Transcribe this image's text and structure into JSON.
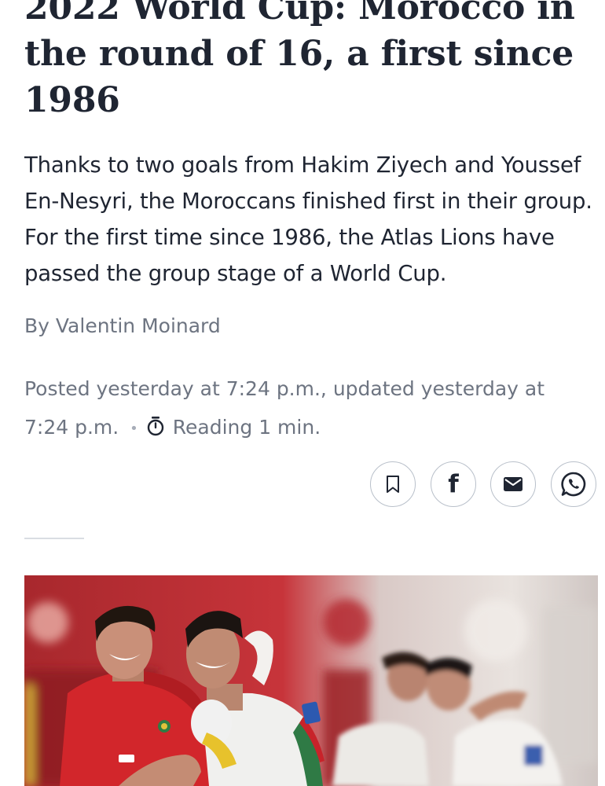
{
  "article": {
    "headline": "2022 World Cup: Morocco in the round of 16, a first since 1986",
    "lede": "Thanks to two goals from Hakim Ziyech and Youssef En-Nesyri, the Moroccans finished first in their group. For the first time since 1986, the Atlas Lions have passed the group stage of a World Cup.",
    "byline": "By Valentin Moinard",
    "posted": "Posted yesterday at 7:24 p.m., updated yesterday at 7:24 p.m.",
    "separator": "•",
    "reading_time": "Reading 1 min."
  },
  "share": {
    "facebook_glyph": "f",
    "buttons": [
      "bookmark-icon",
      "facebook-icon",
      "email-icon",
      "whatsapp-icon"
    ]
  },
  "photo": {
    "content": "celebrating Morocco players",
    "colors": {
      "jersey_red": "#d2262b",
      "jersey_white": "#efefed",
      "background_crowd": "#c03237"
    }
  },
  "colors": {
    "text": "#1f2532",
    "muted": "#6d7481",
    "border": "#b9c0ca",
    "divider": "#d9dde3"
  }
}
